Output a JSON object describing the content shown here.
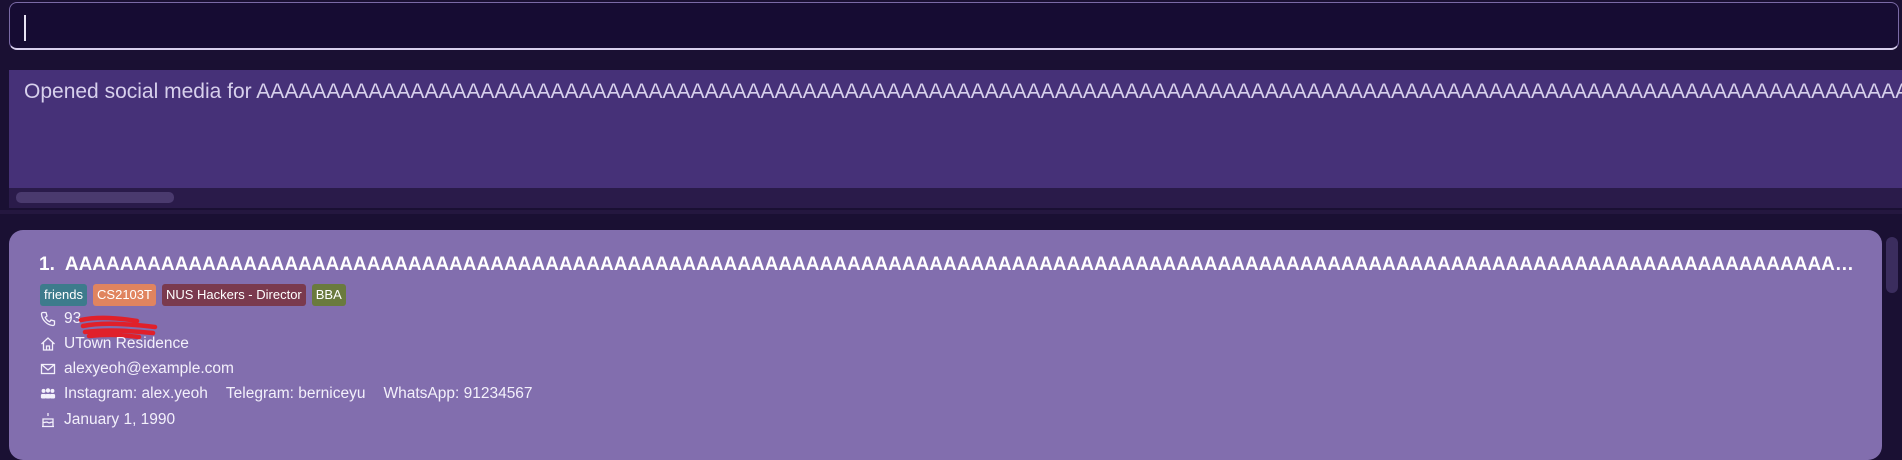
{
  "command_box": {
    "value": ""
  },
  "result_display": {
    "text": "Opened social media for AAAAAAAAAAAAAAAAAAAAAAAAAAAAAAAAAAAAAAAAAAAAAAAAAAAAAAAAAAAAAAAAAAAAAAAAAAAAAAAAAAAAAAAAAAAAAAAAAAAAAAAAAAAAAAAAAAAAAAAAAAAAAAAAAAAAA"
  },
  "person_card": {
    "index": "1.",
    "name": "AAAAAAAAAAAAAAAAAAAAAAAAAAAAAAAAAAAAAAAAAAAAAAAAAAAAAAAAAAAAAAAAAAAAAAAAAAAAAAAAAAAAAAAAAAAAAAAAAAAAAAAAAAAAAAAAAAAAAAAAAAAAAAAAAAAA",
    "tags": [
      {
        "label": "friends",
        "color": "#3d7b8c"
      },
      {
        "label": "CS2103T",
        "color": "#e0845f"
      },
      {
        "label": "NUS Hackers - Director",
        "color": "#7a3a4e"
      },
      {
        "label": "BBA",
        "color": "#6a7a3e"
      }
    ],
    "phone": "93",
    "address": "UTown Residence",
    "email": "alexyeoh@example.com",
    "social": {
      "instagram": "Instagram: alex.yeoh",
      "telegram": "Telegram: berniceyu",
      "whatsapp": "WhatsApp: 91234567"
    },
    "birthday": "January 1, 1990"
  },
  "icons": {
    "phone": "phone-icon",
    "address": "home-icon",
    "email": "envelope-icon",
    "social": "people-icon",
    "birthday": "cake-icon"
  },
  "colors": {
    "background": "#1a1033",
    "command_box": "#160c33",
    "result_box": "#463178",
    "list_panel": "#826eae",
    "redaction": "#e0202a"
  }
}
